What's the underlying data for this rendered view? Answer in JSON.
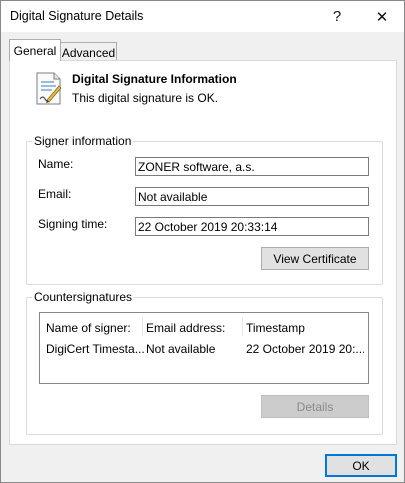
{
  "window": {
    "title": "Digital Signature Details",
    "help_glyph": "?",
    "close_glyph": "✕"
  },
  "tabs": [
    {
      "label": "General",
      "active": true
    },
    {
      "label": "Advanced",
      "active": false
    }
  ],
  "info": {
    "icon": "certificate-document-icon",
    "title": "Digital Signature Information",
    "status": "This digital signature is OK."
  },
  "signer": {
    "group_label": "Signer information",
    "name_label": "Name:",
    "name_value": "ZONER software, a.s.",
    "email_label": "Email:",
    "email_value": "Not available",
    "time_label": "Signing time:",
    "time_value": "22  October  2019 20:33:14",
    "view_cert_label": "View Certificate"
  },
  "countersignatures": {
    "group_label": "Countersignatures",
    "columns": [
      "Name of signer:",
      "Email address:",
      "Timestamp"
    ],
    "rows": [
      [
        "DigiCert Timesta...",
        "Not available",
        "22 October 2019 20:..."
      ]
    ],
    "details_label": "Details",
    "details_enabled": false
  },
  "footer": {
    "ok_label": "OK"
  },
  "colors": {
    "accent": "#0078d7",
    "panel_bg": "#ffffff",
    "window_bg": "#f0f0f0"
  }
}
